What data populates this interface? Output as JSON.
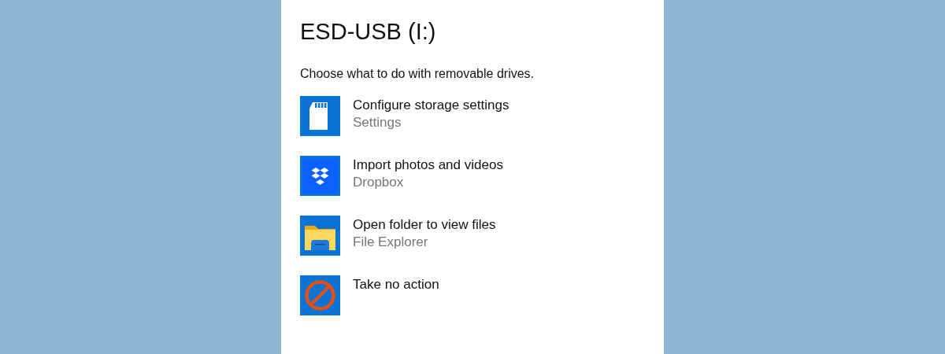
{
  "title": "ESD-USB (I:)",
  "prompt": "Choose what to do with removable drives.",
  "options": [
    {
      "kind": "sdcard",
      "label": "Configure storage settings",
      "app": "Settings"
    },
    {
      "kind": "dropbox",
      "label": "Import photos and videos",
      "app": "Dropbox"
    },
    {
      "kind": "folder",
      "label": "Open folder to view files",
      "app": "File Explorer"
    },
    {
      "kind": "block",
      "label": "Take no action"
    }
  ]
}
